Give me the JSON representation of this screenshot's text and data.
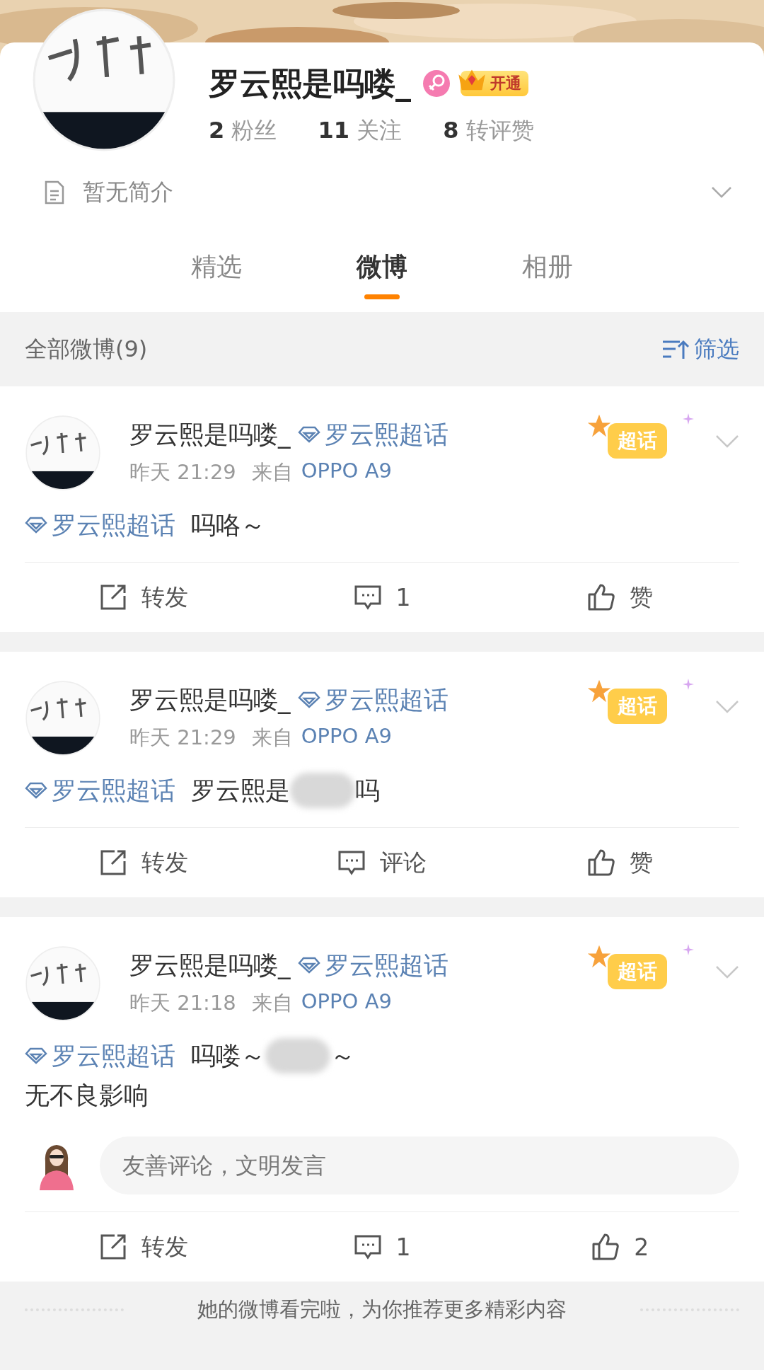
{
  "profile": {
    "name": "罗云熙是吗喽_",
    "vip_label": "开通",
    "stats": [
      {
        "count": "2",
        "label": "粉丝"
      },
      {
        "count": "11",
        "label": "关注"
      },
      {
        "count": "8",
        "label": "转评赞"
      }
    ],
    "bio": "暂无简介"
  },
  "tabs": [
    {
      "label": "精选",
      "selected": false
    },
    {
      "label": "微博",
      "selected": true
    },
    {
      "label": "相册",
      "selected": false
    }
  ],
  "feed_header": {
    "title": "全部微博(9)",
    "filter": "筛选"
  },
  "posts": [
    {
      "author": "罗云熙是吗喽_",
      "topic": "罗云熙超话",
      "badge": "超话",
      "time": "昨天 21:29",
      "source_prefix": "来自",
      "source": "OPPO A9",
      "lines": [
        [
          {
            "kind": "topic",
            "text": "罗云熙超话"
          },
          {
            "kind": "text",
            "text": "吗咯～"
          }
        ]
      ],
      "actions": [
        {
          "kind": "repost",
          "text": "转发"
        },
        {
          "kind": "comment",
          "text": "1"
        },
        {
          "kind": "like",
          "text": "赞"
        }
      ]
    },
    {
      "author": "罗云熙是吗喽_",
      "topic": "罗云熙超话",
      "badge": "超话",
      "time": "昨天 21:29",
      "source_prefix": "来自",
      "source": "OPPO A9",
      "lines": [
        [
          {
            "kind": "topic",
            "text": "罗云熙超话"
          },
          {
            "kind": "text",
            "text": "罗云熙是"
          },
          {
            "kind": "blur"
          },
          {
            "kind": "text",
            "text": "吗"
          }
        ]
      ],
      "actions": [
        {
          "kind": "repost",
          "text": "转发"
        },
        {
          "kind": "comment",
          "text": "评论"
        },
        {
          "kind": "like",
          "text": "赞"
        }
      ]
    },
    {
      "author": "罗云熙是吗喽_",
      "topic": "罗云熙超话",
      "badge": "超话",
      "time": "昨天 21:18",
      "source_prefix": "来自",
      "source": "OPPO A9",
      "lines": [
        [
          {
            "kind": "topic",
            "text": "罗云熙超话"
          },
          {
            "kind": "text",
            "text": "吗喽～"
          },
          {
            "kind": "blur"
          },
          {
            "kind": "text",
            "text": "～"
          }
        ],
        [
          {
            "kind": "text",
            "text": "无不良影响"
          }
        ]
      ],
      "comment_placeholder": "友善评论，文明发言",
      "actions": [
        {
          "kind": "repost",
          "text": "转发"
        },
        {
          "kind": "comment",
          "text": "1"
        },
        {
          "kind": "like",
          "text": "2"
        }
      ]
    }
  ],
  "footer": {
    "text": "她的微博看完啦，为你推荐更多精彩内容"
  }
}
